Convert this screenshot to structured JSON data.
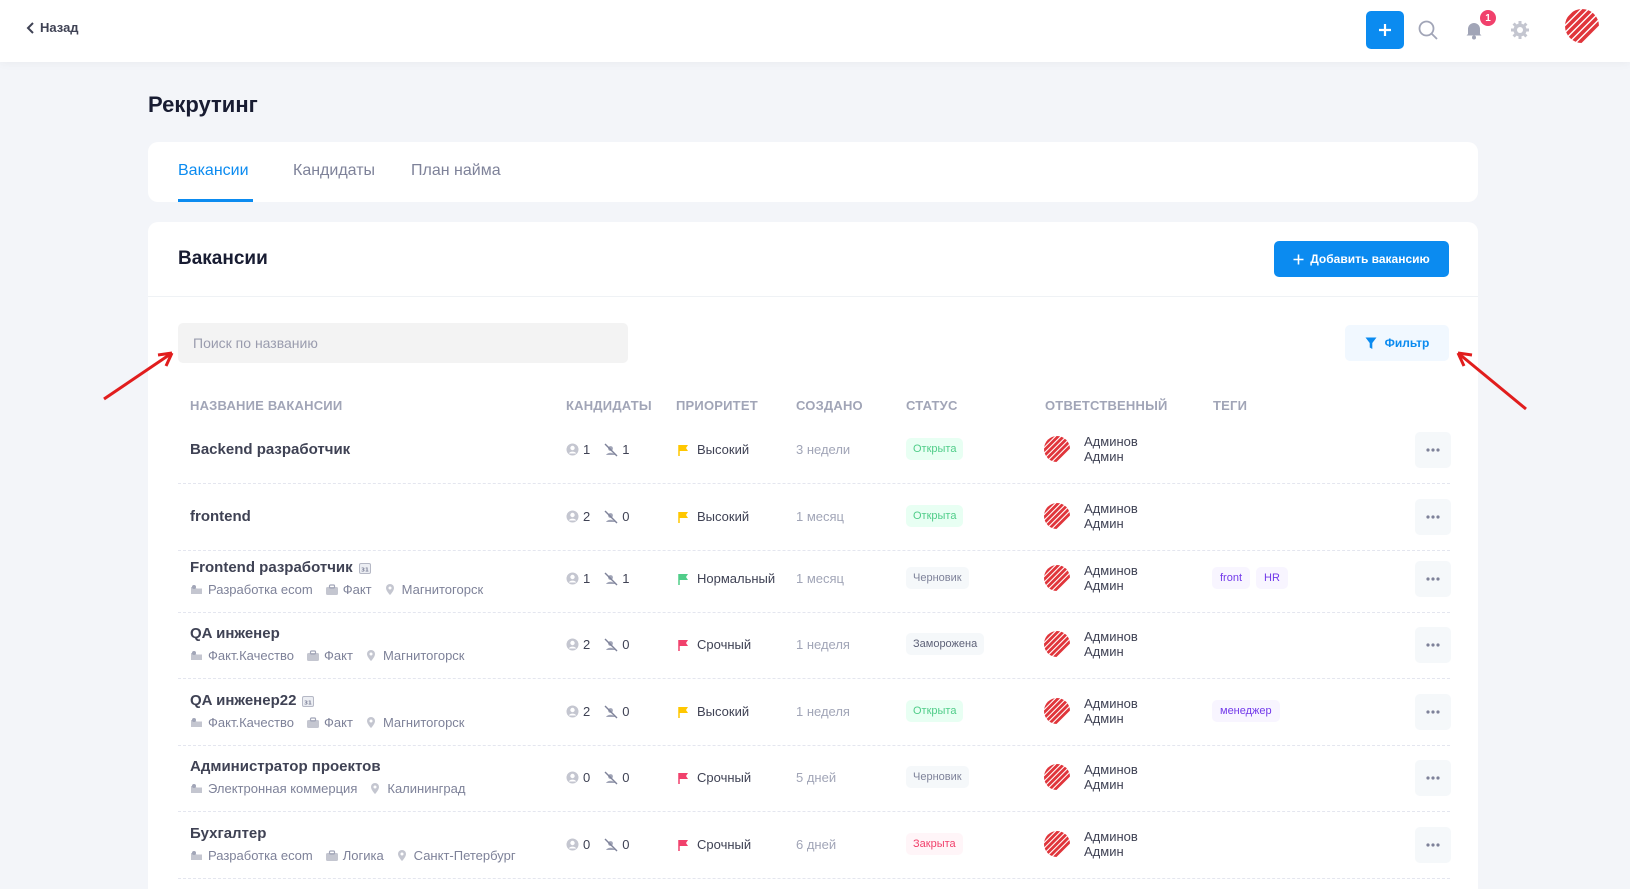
{
  "topbar": {
    "back_label": "Назад",
    "notification_count": "1"
  },
  "page": {
    "title": "Рекрутинг"
  },
  "tabs": [
    {
      "label": "Вакансии",
      "active": true
    },
    {
      "label": "Кандидаты",
      "active": false
    },
    {
      "label": "План найма",
      "active": false
    }
  ],
  "card": {
    "title": "Вакансии",
    "add_button": "Добавить вакансию",
    "search_placeholder": "Поиск по названию",
    "filter_button": "Фильтр"
  },
  "table": {
    "headers": [
      "НАЗВАНИЕ ВАКАНСИИ",
      "КАНДИДАТЫ",
      "ПРИОРИТЕТ",
      "СОЗДАНО",
      "СТАТУС",
      "ОТВЕТСТВЕННЫЙ",
      "ТЕГИ"
    ],
    "rows": [
      {
        "name": "Backend разработчик",
        "calendar": false,
        "meta": [],
        "candidates": "1",
        "rejected": "1",
        "priority": "Высокий",
        "priority_color": "#ffc700",
        "created": "3 недели",
        "status": "Открыта",
        "status_kind": "open",
        "owner": [
          "Админов",
          "Админ"
        ],
        "tags": []
      },
      {
        "name": "frontend",
        "calendar": false,
        "meta": [],
        "candidates": "2",
        "rejected": "0",
        "priority": "Высокий",
        "priority_color": "#ffc700",
        "created": "1 месяц",
        "status": "Открыта",
        "status_kind": "open",
        "owner": [
          "Админов",
          "Админ"
        ],
        "tags": []
      },
      {
        "name": "Frontend разработчик",
        "calendar": true,
        "meta": [
          "Разработка ecom",
          "Факт",
          "Магнитогорск"
        ],
        "candidates": "1",
        "rejected": "1",
        "priority": "Нормальный",
        "priority_color": "#50cd89",
        "created": "1 месяц",
        "status": "Черновик",
        "status_kind": "draft",
        "owner": [
          "Админов",
          "Админ"
        ],
        "tags": [
          "front",
          "HR"
        ]
      },
      {
        "name": "QA инженер",
        "calendar": false,
        "meta": [
          "Факт.Качество",
          "Факт",
          "Магнитогорск"
        ],
        "candidates": "2",
        "rejected": "0",
        "priority": "Срочный",
        "priority_color": "#f1416c",
        "created": "1 неделя",
        "status": "Заморожена",
        "status_kind": "frozen",
        "owner": [
          "Админов",
          "Админ"
        ],
        "tags": []
      },
      {
        "name": "QA инженер22",
        "calendar": true,
        "meta": [
          "Факт.Качество",
          "Факт",
          "Магнитогорск"
        ],
        "candidates": "2",
        "rejected": "0",
        "priority": "Высокий",
        "priority_color": "#ffc700",
        "created": "1 неделя",
        "status": "Открыта",
        "status_kind": "open",
        "owner": [
          "Админов",
          "Админ"
        ],
        "tags": [
          "менеджер"
        ]
      },
      {
        "name": "Администратор проектов",
        "calendar": false,
        "meta": [
          "Электронная коммерция",
          "Калининград"
        ],
        "candidates": "0",
        "rejected": "0",
        "priority": "Срочный",
        "priority_color": "#f1416c",
        "created": "5 дней",
        "status": "Черновик",
        "status_kind": "draft",
        "owner": [
          "Админов",
          "Админ"
        ],
        "tags": []
      },
      {
        "name": "Бухгалтер",
        "calendar": false,
        "meta": [
          "Разработка ecom",
          "Логика",
          "Санкт-Петербург"
        ],
        "candidates": "0",
        "rejected": "0",
        "priority": "Срочный",
        "priority_color": "#f1416c",
        "created": "6 дней",
        "status": "Закрыта",
        "status_kind": "closed",
        "owner": [
          "Админов",
          "Админ"
        ],
        "tags": []
      }
    ]
  },
  "colors": {
    "accent": "#0b8bf0",
    "annotation_arrow": "#e11d1d"
  }
}
